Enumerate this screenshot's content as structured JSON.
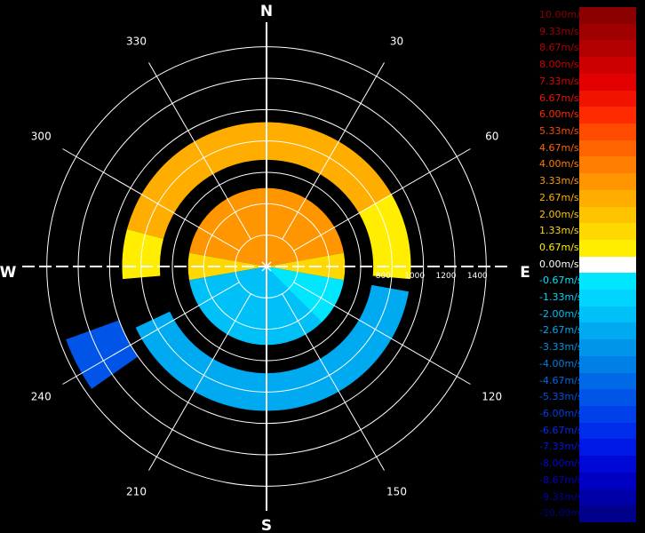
{
  "chart_data": {
    "type": "polar-ppi",
    "center_marker": "cross",
    "compass": {
      "north": "N",
      "east": "E",
      "south": "S",
      "west": "W"
    },
    "azimuth_labels": [
      "30",
      "60",
      "120",
      "150",
      "210",
      "240",
      "300",
      "330"
    ],
    "azimuths_deg": [
      30,
      60,
      120,
      150,
      210,
      240,
      300,
      330
    ],
    "range_labels": [
      "800",
      "1000",
      "1200",
      "1400"
    ],
    "range_values": [
      800,
      1000,
      1200,
      1400
    ],
    "ring_values": [
      200,
      400,
      600,
      800,
      1000,
      1200,
      1400
    ],
    "max_range": 1500,
    "legend": [
      {
        "label": "10.00m/s",
        "value": 10.0,
        "color": "#8b0000"
      },
      {
        "label": "9.33m/s",
        "value": 9.33,
        "color": "#a00000"
      },
      {
        "label": "8.67m/s",
        "value": 8.67,
        "color": "#b40000"
      },
      {
        "label": "8.00m/s",
        "value": 8.0,
        "color": "#cc0000"
      },
      {
        "label": "7.33m/s",
        "value": 7.33,
        "color": "#e20000"
      },
      {
        "label": "6.67m/s",
        "value": 6.67,
        "color": "#f21200"
      },
      {
        "label": "6.00m/s",
        "value": 6.0,
        "color": "#ff2a00"
      },
      {
        "label": "5.33m/s",
        "value": 5.33,
        "color": "#ff4a00"
      },
      {
        "label": "4.67m/s",
        "value": 4.67,
        "color": "#ff6400"
      },
      {
        "label": "4.00m/s",
        "value": 4.0,
        "color": "#ff7d00"
      },
      {
        "label": "3.33m/s",
        "value": 3.33,
        "color": "#ff9600"
      },
      {
        "label": "2.67m/s",
        "value": 2.67,
        "color": "#ffae00"
      },
      {
        "label": "2.00m/s",
        "value": 2.0,
        "color": "#ffc400"
      },
      {
        "label": "1.33m/s",
        "value": 1.33,
        "color": "#ffd800"
      },
      {
        "label": "0.67m/s",
        "value": 0.67,
        "color": "#ffee00"
      },
      {
        "label": "0.00m/s",
        "value": 0.0,
        "color": "#ffffff"
      },
      {
        "label": "-0.67m/s",
        "value": -0.67,
        "color": "#00e6ff"
      },
      {
        "label": "-1.33m/s",
        "value": -1.33,
        "color": "#00d4ff"
      },
      {
        "label": "-2.00m/s",
        "value": -2.0,
        "color": "#00c0f8"
      },
      {
        "label": "-2.67m/s",
        "value": -2.67,
        "color": "#00aaf0"
      },
      {
        "label": "-3.33m/s",
        "value": -3.33,
        "color": "#0095ea"
      },
      {
        "label": "-4.00m/s",
        "value": -4.0,
        "color": "#0080e6"
      },
      {
        "label": "-4.67m/s",
        "value": -4.67,
        "color": "#006ae6"
      },
      {
        "label": "-5.33m/s",
        "value": -5.33,
        "color": "#0055e8"
      },
      {
        "label": "-6.00m/s",
        "value": -6.0,
        "color": "#0040ea"
      },
      {
        "label": "-6.67m/s",
        "value": -6.67,
        "color": "#002cec"
      },
      {
        "label": "-7.33m/s",
        "value": -7.33,
        "color": "#0018e6"
      },
      {
        "label": "-8.00m/s",
        "value": -8.0,
        "color": "#0008d6"
      },
      {
        "label": "-8.67m/s",
        "value": -8.67,
        "color": "#0000c2"
      },
      {
        "label": "-9.33m/s",
        "value": -9.33,
        "color": "#0000a8"
      },
      {
        "label": "-10.00m/s",
        "value": -10.0,
        "color": "#00008a"
      }
    ],
    "data_bands": [
      {
        "r0": 0,
        "r1": 500,
        "a0": 280,
        "a1": 440,
        "value": 3.2
      },
      {
        "r0": 0,
        "r1": 500,
        "a0": 80,
        "a1": 100,
        "value": 1.4
      },
      {
        "r0": 0,
        "r1": 500,
        "a0": 260,
        "a1": 280,
        "value": 1.2
      },
      {
        "r0": 0,
        "r1": 500,
        "a0": 100,
        "a1": 260,
        "value": -2.2
      },
      {
        "r0": 0,
        "r1": 500,
        "a0": 100,
        "a1": 135,
        "value": -0.7
      },
      {
        "r0": 680,
        "r1": 920,
        "a0": 285,
        "a1": 420,
        "value": 2.4
      },
      {
        "r0": 680,
        "r1": 920,
        "a0": 60,
        "a1": 95,
        "value": 1.0
      },
      {
        "r0": 680,
        "r1": 920,
        "a0": 265,
        "a1": 285,
        "value": 0.7
      },
      {
        "r0": 680,
        "r1": 920,
        "a0": 100,
        "a1": 245,
        "value": -2.6
      },
      {
        "r0": 1000,
        "r1": 1360,
        "a0": 235,
        "a1": 250,
        "value": -5.4
      }
    ]
  }
}
